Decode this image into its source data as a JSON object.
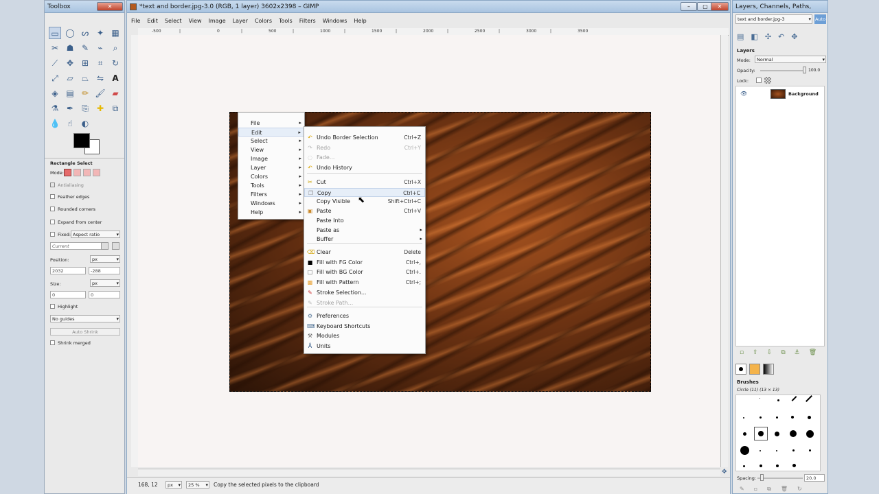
{
  "toolbox": {
    "title": "Toolbox",
    "options_title": "Rectangle Select",
    "mode_label": "Mode:",
    "antialiasing": "Antialiasing",
    "feather_edges": "Feather edges",
    "rounded_corners": "Rounded corners",
    "expand_from_center": "Expand from center",
    "fixed_label": "Fixed:",
    "fixed_value": "Aspect ratio",
    "current_value": "Current",
    "position_label": "Position:",
    "position_unit": "px",
    "pos_x": "2032",
    "pos_y": "-288",
    "size_label": "Size:",
    "size_unit": "px",
    "size_w": "0",
    "size_h": "0",
    "highlight": "Highlight",
    "guides_value": "No guides",
    "auto_shrink": "Auto Shrink",
    "shrink_merged": "Shrink merged"
  },
  "main": {
    "title": "*text and border.jpg-3.0 (RGB, 1 layer) 3602x2398 – GIMP",
    "menu": [
      "File",
      "Edit",
      "Select",
      "View",
      "Image",
      "Layer",
      "Colors",
      "Tools",
      "Filters",
      "Windows",
      "Help"
    ],
    "ruler_ticks": [
      "-500",
      "|",
      "0",
      "|",
      "500",
      "|",
      "1000",
      "|",
      "1500",
      "|",
      "2000",
      "|",
      "2500",
      "|",
      "3000",
      "|",
      "3500"
    ],
    "status": {
      "coords": "168, 12",
      "unit": "px",
      "zoom": "25 %",
      "message": "Copy the selected pixels to the clipboard"
    }
  },
  "image_menu": {
    "items": [
      "File",
      "Edit",
      "Select",
      "View",
      "Image",
      "Layer",
      "Colors",
      "Tools",
      "Filters",
      "Windows",
      "Help"
    ]
  },
  "edit_menu": {
    "items": [
      {
        "label": "Undo Border Selection",
        "shortcut": "Ctrl+Z",
        "icon": "undo-icon",
        "disabled": false
      },
      {
        "label": "Redo",
        "shortcut": "Ctrl+Y",
        "icon": "redo-icon",
        "disabled": true
      },
      {
        "label": "Fade...",
        "shortcut": "",
        "icon": "fade-icon",
        "disabled": true
      },
      {
        "label": "Undo History",
        "shortcut": "",
        "icon": "undo-history-icon",
        "disabled": false
      },
      {
        "label": "Cut",
        "shortcut": "Ctrl+X",
        "icon": "scissors-icon",
        "disabled": false
      },
      {
        "label": "Copy",
        "shortcut": "Ctrl+C",
        "icon": "copy-icon",
        "disabled": false
      },
      {
        "label": "Copy Visible",
        "shortcut": "Shift+Ctrl+C",
        "icon": "",
        "disabled": false
      },
      {
        "label": "Paste",
        "shortcut": "Ctrl+V",
        "icon": "paste-icon",
        "disabled": false
      },
      {
        "label": "Paste Into",
        "shortcut": "",
        "icon": "",
        "disabled": false
      },
      {
        "label": "Paste as",
        "shortcut": "",
        "icon": "",
        "disabled": false
      },
      {
        "label": "Buffer",
        "shortcut": "",
        "icon": "",
        "disabled": false
      },
      {
        "label": "Clear",
        "shortcut": "Delete",
        "icon": "clear-icon",
        "disabled": false
      },
      {
        "label": "Fill with FG Color",
        "shortcut": "Ctrl+,",
        "icon": "fg-color-icon",
        "disabled": false
      },
      {
        "label": "Fill with BG Color",
        "shortcut": "Ctrl+.",
        "icon": "bg-color-icon",
        "disabled": false
      },
      {
        "label": "Fill with Pattern",
        "shortcut": "Ctrl+;",
        "icon": "pattern-icon",
        "disabled": false
      },
      {
        "label": "Stroke Selection...",
        "shortcut": "",
        "icon": "stroke-selection-icon",
        "disabled": false
      },
      {
        "label": "Stroke Path...",
        "shortcut": "",
        "icon": "stroke-path-icon",
        "disabled": true
      },
      {
        "label": "Preferences",
        "shortcut": "",
        "icon": "preferences-icon",
        "disabled": false
      },
      {
        "label": "Keyboard Shortcuts",
        "shortcut": "",
        "icon": "keyboard-icon",
        "disabled": false
      },
      {
        "label": "Modules",
        "shortcut": "",
        "icon": "modules-icon",
        "disabled": false
      },
      {
        "label": "Units",
        "shortcut": "",
        "icon": "units-icon",
        "disabled": false
      }
    ]
  },
  "dock": {
    "title": "Layers, Channels, Paths, Undo, N...",
    "image_select": "text and border.jpg-3",
    "auto_label": "Auto",
    "layers_title": "Layers",
    "mode_label": "Mode:",
    "mode_value": "Normal",
    "opacity_label": "Opacity:",
    "opacity_value": "100.0",
    "lock_label": "Lock:",
    "layer_name": "Background",
    "brushes_title": "Brushes",
    "brush_name": "Circle (11) (13 × 13)",
    "spacing_label": "Spacing:",
    "spacing_value": "20.0"
  }
}
